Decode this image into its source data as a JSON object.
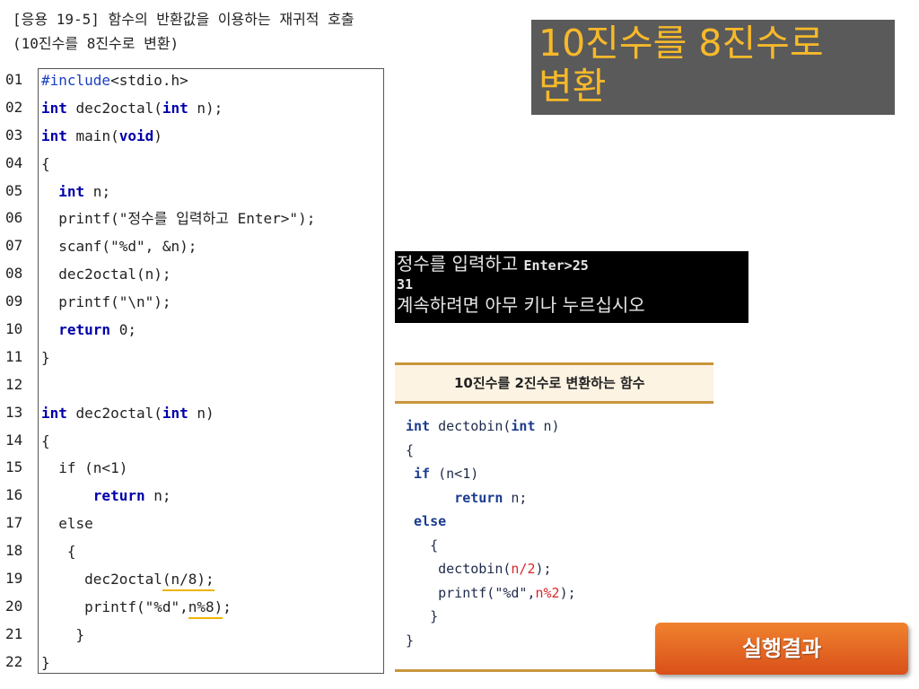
{
  "caption": {
    "line1": "[응용 19-5] 함수의 반환값을 이용하는 재귀적 호출",
    "line2": "(10진수를 8진수로 변환)"
  },
  "title": {
    "line1": "10진수를 8진수로",
    "line2": "변환"
  },
  "code": {
    "line_numbers": [
      "01",
      "02",
      "03",
      "04",
      "05",
      "06",
      "07",
      "08",
      "09",
      "10",
      "11",
      "12",
      "13",
      "14",
      "15",
      "16",
      "17",
      "18",
      "19",
      "20",
      "21",
      "22"
    ],
    "tokens": {
      "include": "#include",
      "include_rest": "<stdio.h>",
      "int": "int",
      "void": "void",
      "return": "return",
      "l2_rest1": " dec2octal(",
      "l2_rest2": " n);",
      "l3_rest1": " main(",
      "l3_rest2": ")",
      "open_brace": "{",
      "close_brace": "}",
      "l5_rest": " n;",
      "l6": "  printf(\"정수를 입력하고 Enter>\");",
      "l7": "  scanf(\"%d\", &n);",
      "l8": "  dec2octal(n);",
      "l9": "  printf(\"\\n\");",
      "l10_rest": " 0;",
      "l13_rest1": " dec2octal(",
      "l13_rest2": " n)",
      "l15": "  if (n<1)",
      "l16_rest": " n;",
      "l17": "  else",
      "l18": "   {",
      "l19_pre": "     dec2octal",
      "l19_ul": "(n/8);",
      "l20_pre": "     printf(\"%d\",",
      "l20_ul": "n%8)",
      "l20_post": ";",
      "l21": "    }"
    }
  },
  "console": {
    "line1_kr": "정수를 입력하고 ",
    "line1_en": "Enter>25",
    "line2": "31",
    "line3": "계속하려면 아무 키나 누르십시오"
  },
  "reference": {
    "header": "10진수를 2진수로 변환하는 함수",
    "int": "int",
    "if": "if",
    "return": "return",
    "else": "else",
    "r1_rest": " dectobin(",
    "r1_rest2": " n)",
    "open_brace": "{",
    "close_brace": "}",
    "r3_rest": " (n<1)",
    "r4_rest": " n;",
    "r6": "   {",
    "r7_pre": "    dectobin(",
    "r7_red": "n/2",
    "r7_post": ");",
    "r8_pre": "    printf(\"%d\",",
    "r8_red": "n%2",
    "r8_post": ");",
    "r9": "   }"
  },
  "result_button": "실행결과",
  "colors": {
    "title_bg": "#5a5a5a",
    "title_text": "#f7b92a",
    "keyword": "#0000aa",
    "underline": "#f0b400",
    "ref_border": "#c9963c",
    "button": "#e8662a"
  }
}
